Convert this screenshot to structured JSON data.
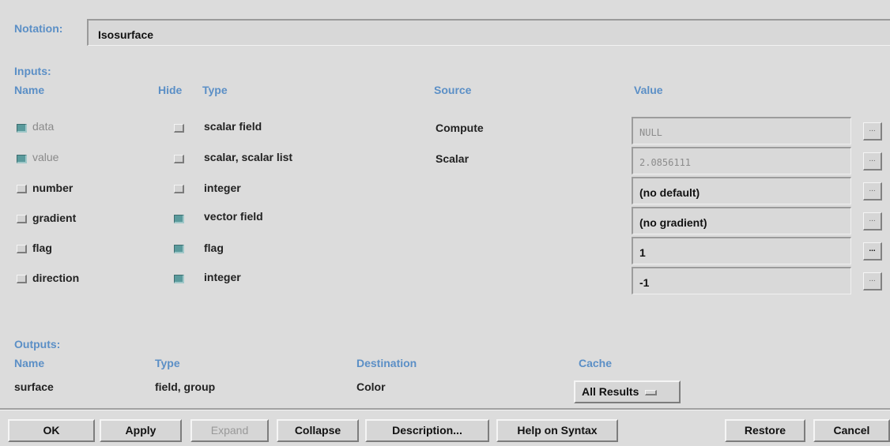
{
  "notation": {
    "label": "Notation:",
    "value": "Isosurface"
  },
  "inputs": {
    "section_label": "Inputs:",
    "headers": {
      "name": "Name",
      "hide": "Hide",
      "type": "Type",
      "source": "Source",
      "value": "Value"
    },
    "rows": [
      {
        "name": "data",
        "checked": true,
        "disabled": true,
        "hide": false,
        "type": "scalar field",
        "source": "Compute",
        "value": "NULL",
        "value_dim": true
      },
      {
        "name": "value",
        "checked": true,
        "disabled": true,
        "hide": false,
        "type": "scalar, scalar list",
        "source": "Scalar",
        "value": "2.0856111",
        "value_dim": true
      },
      {
        "name": "number",
        "checked": false,
        "disabled": false,
        "hide": false,
        "type": "integer",
        "source": "",
        "value": "(no default)",
        "value_dim": false
      },
      {
        "name": "gradient",
        "checked": false,
        "disabled": false,
        "hide": true,
        "type": "vector field",
        "source": "",
        "value": "(no gradient)",
        "value_dim": false
      },
      {
        "name": "flag",
        "checked": false,
        "disabled": false,
        "hide": true,
        "type": "flag",
        "source": "",
        "value": "1",
        "value_dim": false
      },
      {
        "name": "direction",
        "checked": false,
        "disabled": false,
        "hide": true,
        "type": "integer",
        "source": "",
        "value": "-1",
        "value_dim": false
      }
    ],
    "dots_label": "..."
  },
  "outputs": {
    "section_label": "Outputs:",
    "headers": {
      "name": "Name",
      "type": "Type",
      "destination": "Destination",
      "cache": "Cache"
    },
    "rows": [
      {
        "name": "surface",
        "type": "field, group",
        "destination": "Color",
        "cache": "All Results"
      }
    ]
  },
  "buttons": {
    "ok": "OK",
    "apply": "Apply",
    "expand": "Expand",
    "collapse": "Collapse",
    "description": "Description...",
    "help": "Help on Syntax",
    "restore": "Restore",
    "cancel": "Cancel"
  },
  "colors": {
    "label_blue": "#5b8fc6",
    "check_on": "#5a9a9c",
    "background": "#dcdcdc"
  }
}
